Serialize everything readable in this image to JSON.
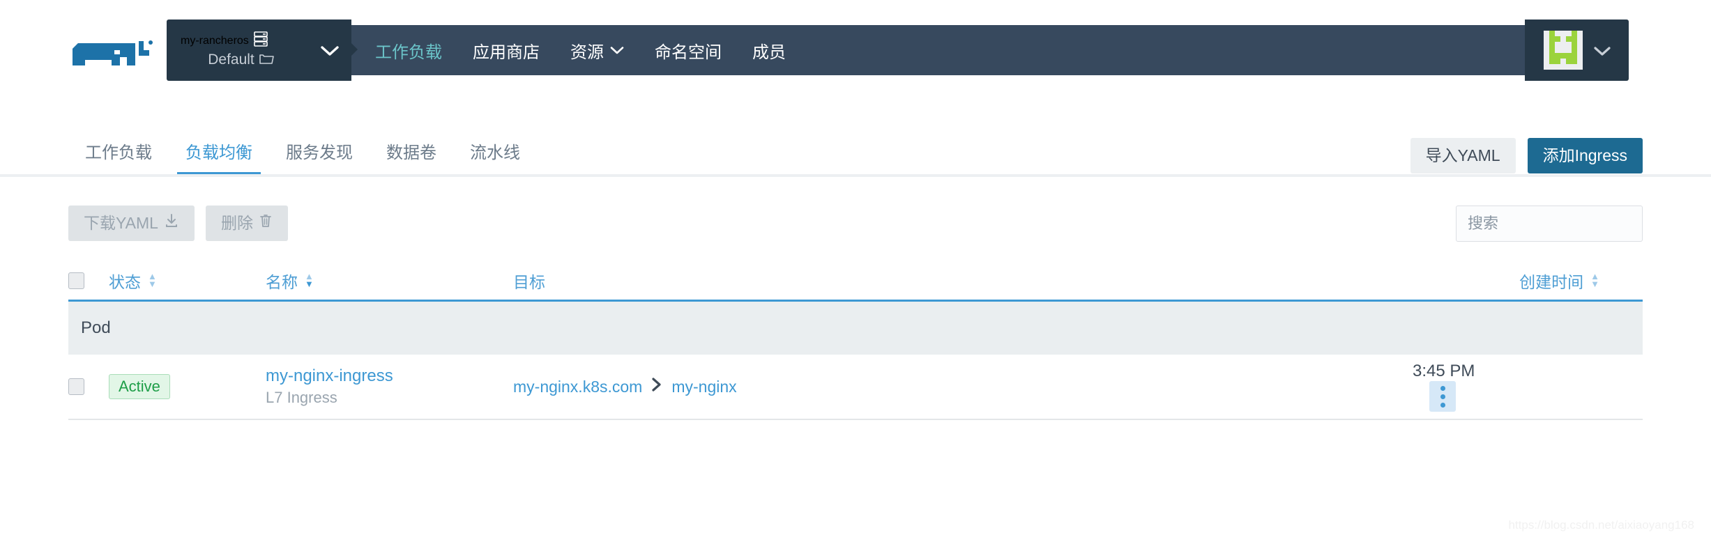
{
  "brand": {
    "logo_name": "rancher-cow-logo",
    "logo_color": "#1d72a8"
  },
  "header": {
    "context": {
      "cluster_name": "my-rancheros",
      "cluster_icon": "server-stack-icon",
      "project_name": "Default",
      "project_icon": "folder-icon",
      "caret_icon": "chevron-down-icon"
    },
    "nav": [
      {
        "label": "工作负载",
        "active": true,
        "has_caret": false
      },
      {
        "label": "应用商店",
        "active": false,
        "has_caret": false
      },
      {
        "label": "资源",
        "active": false,
        "has_caret": true
      },
      {
        "label": "命名空间",
        "active": false,
        "has_caret": false
      },
      {
        "label": "成员",
        "active": false,
        "has_caret": false
      }
    ],
    "user": {
      "avatar_name": "user-avatar-identicon",
      "avatar_color": "#9bd33c",
      "caret_icon": "chevron-down-icon"
    },
    "colors": {
      "bar": "#37495e",
      "selector": "#253746",
      "active_nav": "#6bc4c9"
    }
  },
  "tabs": [
    {
      "label": "工作负载",
      "active": false
    },
    {
      "label": "负载均衡",
      "active": true
    },
    {
      "label": "服务发现",
      "active": false
    },
    {
      "label": "数据卷",
      "active": false
    },
    {
      "label": "流水线",
      "active": false
    }
  ],
  "page_actions": {
    "import_yaml": "导入YAML",
    "add_ingress": "添加Ingress"
  },
  "toolbar": {
    "download_yaml": "下载YAML",
    "download_icon": "download-icon",
    "delete": "删除",
    "delete_icon": "trash-icon"
  },
  "search": {
    "placeholder": "搜索",
    "value": ""
  },
  "table": {
    "columns": {
      "state": "状态",
      "name": "名称",
      "target": "目标",
      "created": "创建时间"
    },
    "sort": {
      "state": "none",
      "name": "desc",
      "created": "none"
    },
    "groups": [
      {
        "label": "Pod",
        "rows": [
          {
            "state": "Active",
            "name": "my-nginx-ingress",
            "subtitle": "L7 Ingress",
            "target_host": "my-nginx.k8s.com",
            "target_arrow": "chevron-right-icon",
            "target_service": "my-nginx",
            "created": "3:45 PM",
            "menu_icon": "kebab-menu-icon"
          }
        ]
      }
    ]
  },
  "watermark": "https://blog.csdn.net/aixiaoyang168"
}
